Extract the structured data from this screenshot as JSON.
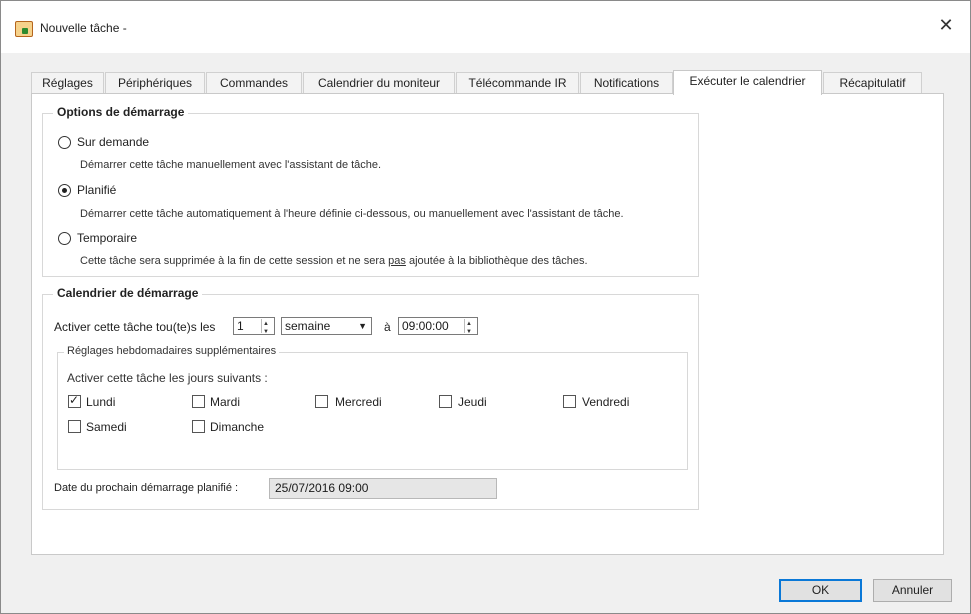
{
  "window": {
    "title": "Nouvelle tâche -"
  },
  "tabs": [
    {
      "label": "Réglages"
    },
    {
      "label": "Périphériques"
    },
    {
      "label": "Commandes"
    },
    {
      "label": "Calendrier du moniteur"
    },
    {
      "label": "Télécommande IR"
    },
    {
      "label": "Notifications"
    },
    {
      "label": "Exécuter le calendrier"
    },
    {
      "label": "Récapitulatif"
    }
  ],
  "active_tab": "Exécuter le calendrier",
  "startup_options": {
    "title": "Options de démarrage",
    "on_demand": {
      "label": "Sur demande",
      "desc": "Démarrer cette tâche manuellement avec l'assistant de tâche.",
      "selected": false
    },
    "scheduled": {
      "label": "Planifié",
      "desc": "Démarrer cette tâche automatiquement à l'heure définie ci-dessous, ou manuellement avec l'assistant de tâche.",
      "selected": true
    },
    "temporary": {
      "label": "Temporaire",
      "desc_before": "Cette tâche sera supprimée à la fin de cette session et ne sera ",
      "desc_emph": "pas",
      "desc_after": " ajoutée à la bibliothèque des tâches.",
      "selected": false
    }
  },
  "schedule": {
    "title": "Calendrier de démarrage",
    "activate_label": "Activer cette tâche tou(te)s les",
    "interval_value": "1",
    "period_value": "semaine",
    "at_label": "à",
    "time_value": "09:00:00",
    "weekly": {
      "title": "Réglages hebdomadaires supplémentaires",
      "prompt": "Activer cette tâche les jours suivants :",
      "days": [
        {
          "label": "Lundi",
          "checked": true
        },
        {
          "label": "Mardi",
          "checked": false
        },
        {
          "label": "Mercredi",
          "checked": false
        },
        {
          "label": "Jeudi",
          "checked": false
        },
        {
          "label": "Vendredi",
          "checked": false
        },
        {
          "label": "Samedi",
          "checked": false
        },
        {
          "label": "Dimanche",
          "checked": false
        }
      ]
    },
    "next_start_label": "Date du prochain démarrage planifié :",
    "next_start_value": "25/07/2016 09:00"
  },
  "buttons": {
    "ok": "OK",
    "cancel": "Annuler"
  },
  "colors": {
    "accent": "#0a78d7"
  }
}
